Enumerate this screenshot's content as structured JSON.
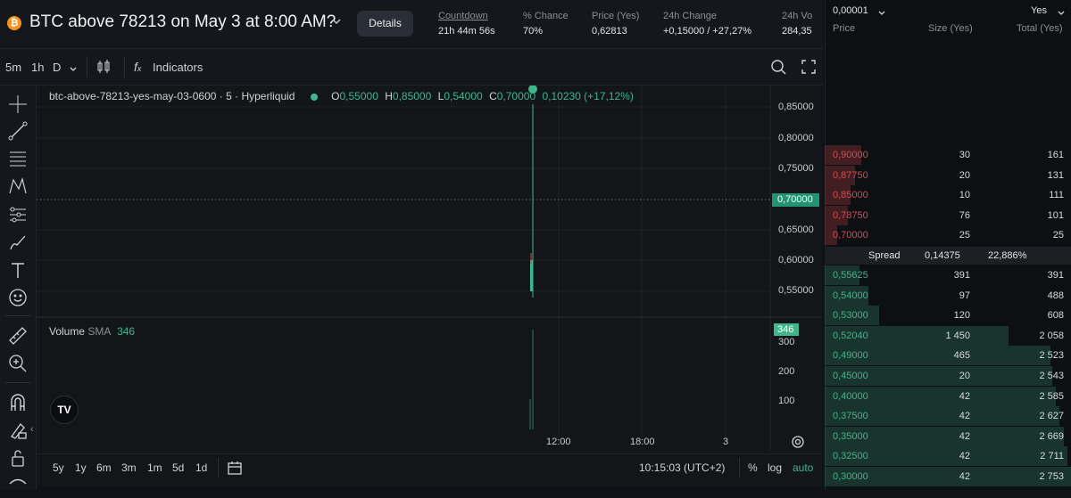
{
  "header": {
    "title": "BTC above 78213 on May 3 at 8:00 AM?",
    "details_label": "Details",
    "stats": [
      {
        "label": "Countdown",
        "value": "21h 44m 56s"
      },
      {
        "label": "% Chance",
        "value": "70%"
      },
      {
        "label": "Price (Yes)",
        "value": "0,62813"
      },
      {
        "label": "24h Change",
        "value": "+0,15000 / +27,27%"
      },
      {
        "label": "24h Vo",
        "value": "284,35"
      }
    ]
  },
  "toolbar": {
    "intervals": [
      "5m",
      "1h",
      "D"
    ],
    "indicators_label": "Indicators"
  },
  "legend": {
    "symbol": "btc-above-78213-yes-may-03-0600 · 5 · Hyperliquid",
    "o_label": "O",
    "o_value": "0,55000",
    "h_label": "H",
    "h_value": "0,85000",
    "l_label": "L",
    "l_value": "0,54000",
    "c_label": "C",
    "c_value": "0,70000",
    "change": "0,10230 (+17,12%)"
  },
  "chart_data": {
    "type": "candlestick",
    "price_axis": [
      "0,85000",
      "0,80000",
      "0,75000",
      "0,70000",
      "0,65000",
      "0,60000",
      "0,55000"
    ],
    "current_price": "0,70000",
    "time_axis": [
      "12:00",
      "18:00",
      "3"
    ],
    "candle": {
      "open": 0.55,
      "high": 0.85,
      "low": 0.54,
      "close": 0.7
    },
    "volume": {
      "label": "Volume",
      "sma_label": "SMA",
      "sma_value": "346",
      "axis": [
        "300",
        "200",
        "100"
      ],
      "current": "346"
    }
  },
  "bottom_bar": {
    "ranges": [
      "5y",
      "1y",
      "6m",
      "3m",
      "1m",
      "5d",
      "1d"
    ],
    "time": "10:15:03 (UTC+2)",
    "percent": "%",
    "log": "log",
    "auto": "auto"
  },
  "orderbook": {
    "tick": "0,00001",
    "side": "Yes",
    "headers": {
      "price": "Price",
      "size": "Size (Yes)",
      "total": "Total (Yes)"
    },
    "asks": [
      {
        "price": "0,90000",
        "size": "30",
        "total": "161"
      },
      {
        "price": "0,87750",
        "size": "20",
        "total": "131"
      },
      {
        "price": "0,85000",
        "size": "10",
        "total": "111"
      },
      {
        "price": "0,78750",
        "size": "76",
        "total": "101"
      },
      {
        "price": "0,70000",
        "size": "25",
        "total": "25"
      }
    ],
    "spread": {
      "label": "Spread",
      "value": "0,14375",
      "pct": "22,886%"
    },
    "bids": [
      {
        "price": "0,55625",
        "size": "391",
        "total": "391"
      },
      {
        "price": "0,54000",
        "size": "97",
        "total": "488"
      },
      {
        "price": "0,53000",
        "size": "120",
        "total": "608"
      },
      {
        "price": "0,52040",
        "size": "1 450",
        "total": "2 058"
      },
      {
        "price": "0,49000",
        "size": "465",
        "total": "2 523"
      },
      {
        "price": "0,45000",
        "size": "20",
        "total": "2 543"
      },
      {
        "price": "0,40000",
        "size": "42",
        "total": "2 585"
      },
      {
        "price": "0,37500",
        "size": "42",
        "total": "2 627"
      },
      {
        "price": "0,35000",
        "size": "42",
        "total": "2 669"
      },
      {
        "price": "0,32500",
        "size": "42",
        "total": "2 711"
      },
      {
        "price": "0,30000",
        "size": "42",
        "total": "2 753"
      }
    ],
    "colors": {
      "ask": "#e0464f",
      "bid": "#3fb68b"
    }
  }
}
